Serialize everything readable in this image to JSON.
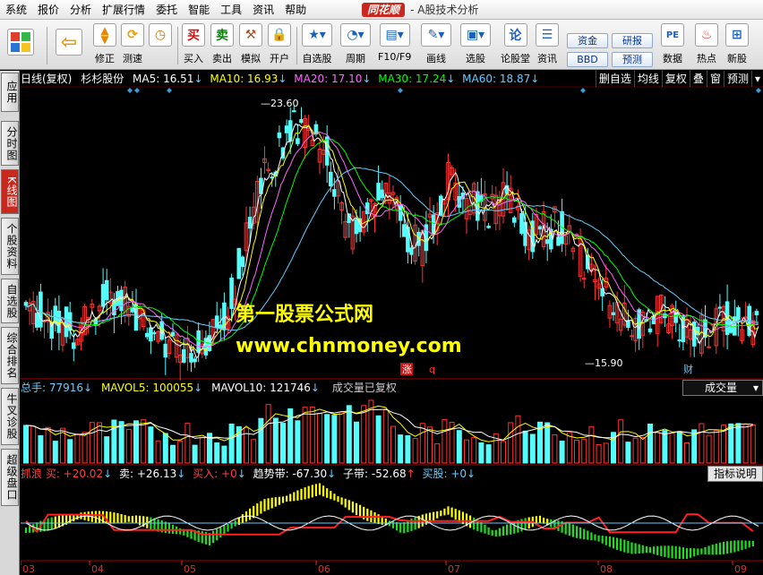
{
  "menu": {
    "items": [
      "系统",
      "报价",
      "分析",
      "扩展行情",
      "委托",
      "智能",
      "工具",
      "资讯",
      "帮助"
    ],
    "brand": "同花顺",
    "title": "- A股技术分析"
  },
  "toolbar": {
    "buttons": [
      {
        "label": "",
        "icon": "windows-logo-icon"
      },
      {
        "label": "",
        "icon": "back-arrow-icon"
      },
      {
        "label": "修正",
        "icon": "up-down-arrows-icon"
      },
      {
        "label": "测速",
        "icon": "clock-icon"
      },
      {
        "label": "买入",
        "icon": "buy-icon",
        "glyph": "买"
      },
      {
        "label": "卖出",
        "icon": "sell-icon",
        "glyph": "卖"
      },
      {
        "label": "模拟",
        "icon": "hammer-icon"
      },
      {
        "label": "开户",
        "icon": "lock-icon"
      },
      {
        "label": "自选股",
        "icon": "star-icon"
      },
      {
        "label": "周期",
        "icon": "period-icon"
      },
      {
        "label": "F10/F9",
        "icon": "f10-icon"
      },
      {
        "label": "画线",
        "icon": "pencil-icon"
      },
      {
        "label": "选股",
        "icon": "screen-icon"
      },
      {
        "label": "论股堂",
        "icon": "chat-icon",
        "glyph": "论"
      },
      {
        "label": "资讯",
        "icon": "news-icon"
      },
      {
        "label": "数据",
        "icon": "pe-icon",
        "glyph": "PE"
      },
      {
        "label": "热点",
        "icon": "fire-icon"
      },
      {
        "label": "新股",
        "icon": "ipo-icon"
      }
    ],
    "pills": [
      "资金",
      "研报",
      "BBD",
      "预测"
    ]
  },
  "left_tabs": [
    "应用",
    "分时图",
    "K线图",
    "个股资料",
    "自选股",
    "综合排名",
    "牛叉诊股",
    "超级盘口"
  ],
  "header": {
    "period": "日线(复权)",
    "stock": "杉杉股份",
    "ma": [
      {
        "label": "MA5: 16.51",
        "color": "#ffffff"
      },
      {
        "label": "MA10: 16.93",
        "color": "#ffff00"
      },
      {
        "label": "MA20: 17.10",
        "color": "#ff66ff"
      },
      {
        "label": "MA30: 17.24",
        "color": "#00ff00"
      },
      {
        "label": "MA60: 18.87",
        "color": "#66ccff"
      }
    ],
    "right_tabs": [
      "删自选",
      "均线",
      "复权",
      "叠",
      "窗",
      "预测"
    ]
  },
  "watermark": {
    "line1": "第一股票公式网",
    "line2": "www.chnmoney.com"
  },
  "price_labels": {
    "high": "23.60",
    "low": "15.90",
    "mark_zhang": "涨",
    "mark_q": "q",
    "mark_cai": "财"
  },
  "volume_header": {
    "items": [
      {
        "label": "总手: 77916",
        "color": "#66ccff"
      },
      {
        "label": "MAVOL5: 100055",
        "color": "#ffff00"
      },
      {
        "label": "MAVOL10: 121746",
        "color": "#ffffff"
      },
      {
        "label": "成交量已复权",
        "color": "#cccccc"
      }
    ],
    "dropdown": "成交量"
  },
  "indicator_header": {
    "items": [
      {
        "label": "抓浪 买: +20.02",
        "color": "#ff4040"
      },
      {
        "label": "卖: +26.13",
        "color": "#ffffff"
      },
      {
        "label": "买入: +0",
        "color": "#ff4040"
      },
      {
        "label": "趋势带: -67.30",
        "color": "#ffffff"
      },
      {
        "label": "子带: -52.68",
        "color": "#ffffff"
      },
      {
        "label": "买股: +0",
        "color": "#66ccff"
      }
    ],
    "button": "指标说明"
  },
  "x_axis": [
    "03",
    "04",
    "05",
    "06",
    "07",
    "08",
    "09"
  ],
  "colors": {
    "up": "#ff3232",
    "down": "#54fcfc",
    "ma5": "#ffffff",
    "ma10": "#ffff00",
    "ma20": "#ff66ff",
    "ma30": "#00ff00",
    "ma60": "#66ccff"
  }
}
